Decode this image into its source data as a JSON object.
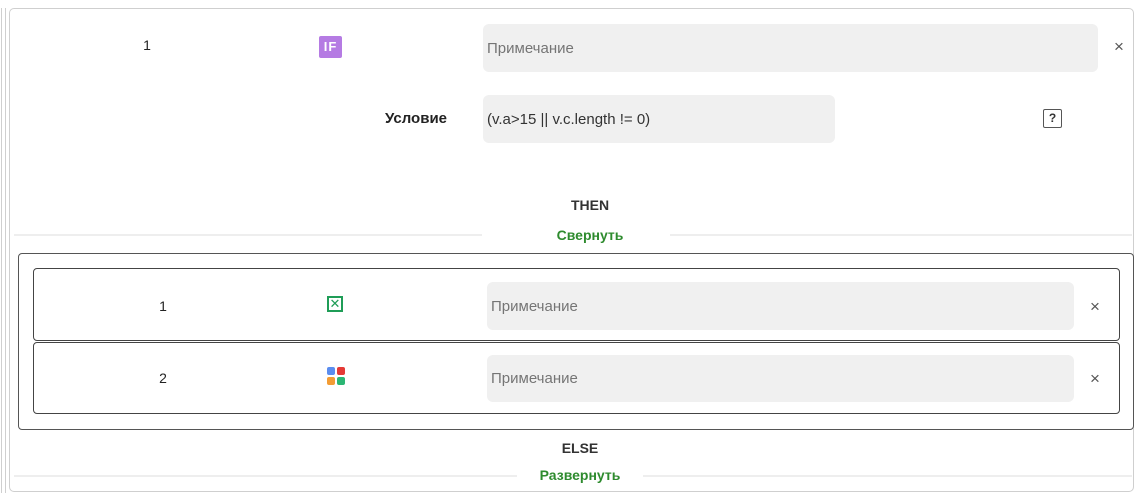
{
  "if_block": {
    "number": "1",
    "badge": "IF",
    "note_placeholder": "Примечание",
    "condition_label": "Условие",
    "condition_value": "(v.a>15 || v.c.length != 0)",
    "help_symbol": "?",
    "close_symbol": "×"
  },
  "then_section": {
    "label": "THEN",
    "toggle": "Свернуть",
    "rows": [
      {
        "number": "1",
        "icon": "excel-x-icon",
        "note_placeholder": "Примечание",
        "close_symbol": "×"
      },
      {
        "number": "2",
        "icon": "calculator-icon",
        "note_placeholder": "Примечание",
        "close_symbol": "×"
      }
    ]
  },
  "else_section": {
    "label": "ELSE",
    "toggle": "Развернуть"
  },
  "colors": {
    "if_badge": "#b57be3",
    "toggle_link": "#2e8b2e",
    "excel_green": "#1f9d57",
    "calc_blue": "#5b8def",
    "calc_red": "#e53935",
    "calc_orange": "#f39c34",
    "calc_green": "#2bb673"
  }
}
